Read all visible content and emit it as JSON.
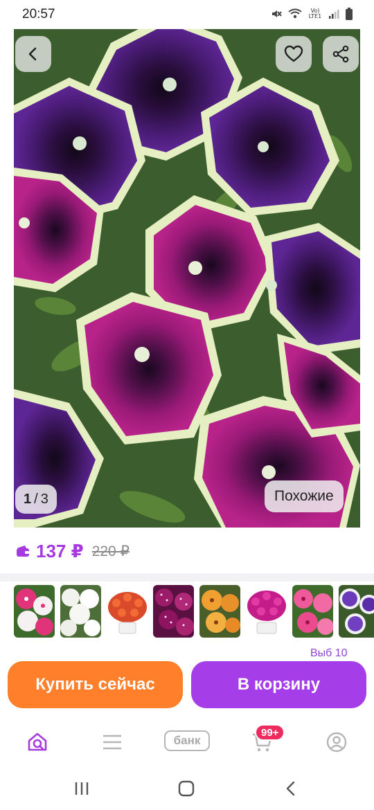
{
  "status_bar": {
    "time": "20:57",
    "network_label": "Vo) LTE1"
  },
  "gallery": {
    "current": "1",
    "separator": "/",
    "total": "3",
    "similar_label": "Похожие"
  },
  "price": {
    "current": "137 ₽",
    "old": "220 ₽",
    "accent_color": "#a63ae0"
  },
  "thumbnails": [
    {
      "name": "pink-white-petunia"
    },
    {
      "name": "white-petunia"
    },
    {
      "name": "red-orange-petunia-pot"
    },
    {
      "name": "magenta-dotted-petunia"
    },
    {
      "name": "orange-petunia"
    },
    {
      "name": "magenta-petunia-pot"
    },
    {
      "name": "pink-petunia"
    },
    {
      "name": "purple-white-petunia"
    }
  ],
  "peek_text": "Выб  10",
  "actions": {
    "buy_now": "Купить сейчас",
    "add_to_cart": "В корзину",
    "buy_now_color": "#ff7f2a",
    "add_to_cart_color": "#a53de9"
  },
  "bottom_nav": {
    "bank_label": "банк",
    "cart_badge": "99+",
    "icons": [
      "home-search-icon",
      "menu-icon",
      "bank-icon",
      "cart-icon",
      "profile-icon"
    ]
  }
}
